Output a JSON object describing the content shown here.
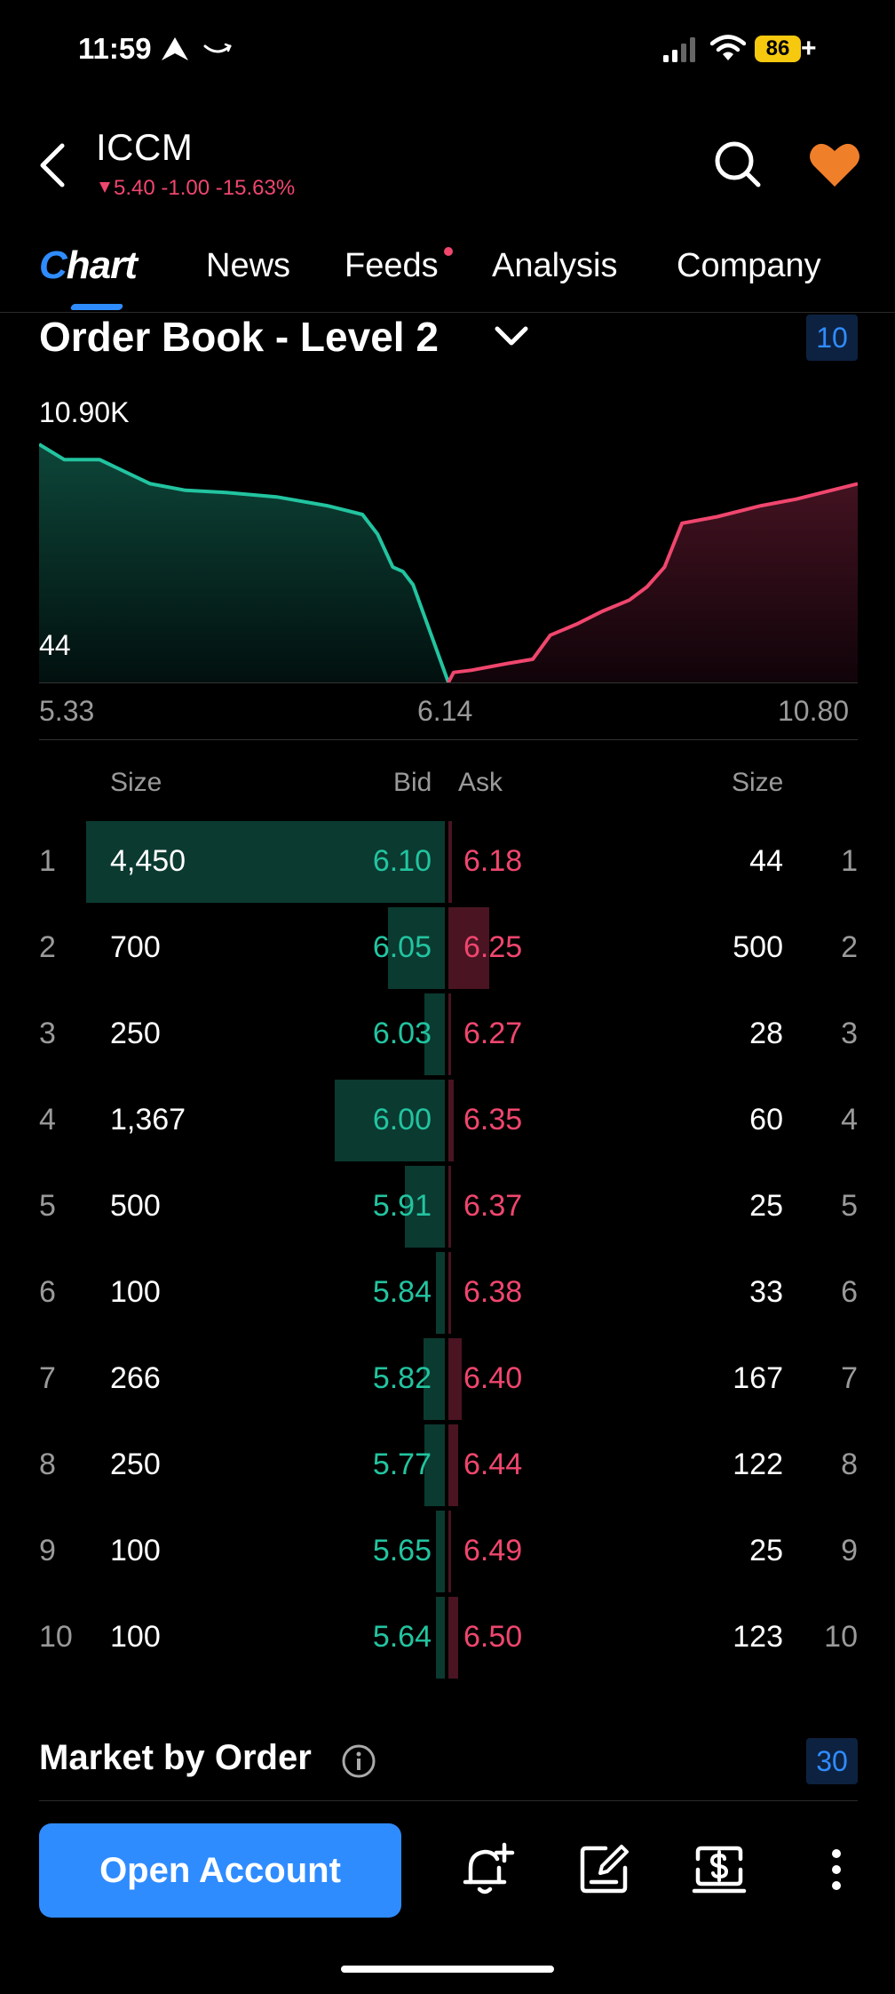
{
  "status_bar": {
    "time": "11:59",
    "battery": "86",
    "battery_suffix": "+"
  },
  "header": {
    "ticker": "ICCM",
    "price": "5.40",
    "change": "-1.00",
    "change_pct": "-15.63%"
  },
  "tabs": [
    {
      "label": "Chart",
      "active": true
    },
    {
      "label": "News"
    },
    {
      "label": "Feeds",
      "has_dot": true
    },
    {
      "label": "Analysis"
    },
    {
      "label": "Company"
    }
  ],
  "order_book": {
    "title": "Order Book - Level 2",
    "depth_badge": "10",
    "depth_chart_max": "10.90K",
    "depth_chart_min": "44",
    "x_labels": [
      "5.33",
      "6.14",
      "10.80"
    ],
    "col_size_left": "Size",
    "col_bid": "Bid",
    "col_ask": "Ask",
    "col_size_right": "Size",
    "rows": [
      {
        "idx": "1",
        "bid_size": "4,450",
        "bid": "6.10",
        "ask": "6.18",
        "ask_size": "44"
      },
      {
        "idx": "2",
        "bid_size": "700",
        "bid": "6.05",
        "ask": "6.25",
        "ask_size": "500"
      },
      {
        "idx": "3",
        "bid_size": "250",
        "bid": "6.03",
        "ask": "6.27",
        "ask_size": "28"
      },
      {
        "idx": "4",
        "bid_size": "1,367",
        "bid": "6.00",
        "ask": "6.35",
        "ask_size": "60"
      },
      {
        "idx": "5",
        "bid_size": "500",
        "bid": "5.91",
        "ask": "6.37",
        "ask_size": "25"
      },
      {
        "idx": "6",
        "bid_size": "100",
        "bid": "5.84",
        "ask": "6.38",
        "ask_size": "33"
      },
      {
        "idx": "7",
        "bid_size": "266",
        "bid": "5.82",
        "ask": "6.40",
        "ask_size": "167"
      },
      {
        "idx": "8",
        "bid_size": "250",
        "bid": "5.77",
        "ask": "6.44",
        "ask_size": "122"
      },
      {
        "idx": "9",
        "bid_size": "100",
        "bid": "5.65",
        "ask": "6.49",
        "ask_size": "25"
      },
      {
        "idx": "10",
        "bid_size": "100",
        "bid": "5.64",
        "ask": "6.50",
        "ask_size": "123"
      }
    ]
  },
  "market_by_order": {
    "title": "Market by Order",
    "badge": "30"
  },
  "bottom_bar": {
    "open_account_label": "Open Account"
  },
  "colors": {
    "accent": "#2f8cff",
    "bid": "#22c4a0",
    "ask": "#f0466e",
    "bid_bar": "#0b3a30",
    "ask_bar": "#4a1422"
  },
  "chart_data": {
    "type": "area",
    "series": [
      {
        "name": "Bid",
        "x": [
          5.33,
          5.38,
          5.45,
          5.55,
          5.62,
          5.7,
          5.8,
          5.9,
          5.97,
          6.0,
          6.03,
          6.05,
          6.07,
          6.1,
          6.14
        ],
        "y": [
          10900,
          10200,
          10200,
          9100,
          8800,
          8700,
          8500,
          8100,
          7700,
          6800,
          5300,
          5100,
          4500,
          2600,
          44
        ]
      },
      {
        "name": "Ask",
        "x": [
          6.14,
          6.2,
          6.4,
          6.8,
          7.1,
          7.3,
          7.6,
          7.9,
          8.2,
          8.4,
          8.6,
          8.8,
          9.2,
          9.7,
          10.1,
          10.5,
          10.8
        ],
        "y": [
          44,
          500,
          600,
          900,
          1100,
          2200,
          2700,
          3300,
          3800,
          4400,
          5300,
          7300,
          7600,
          8100,
          8400,
          8800,
          9100
        ]
      }
    ],
    "xlim": [
      5.33,
      10.8
    ],
    "ylim": [
      44,
      10900
    ]
  }
}
